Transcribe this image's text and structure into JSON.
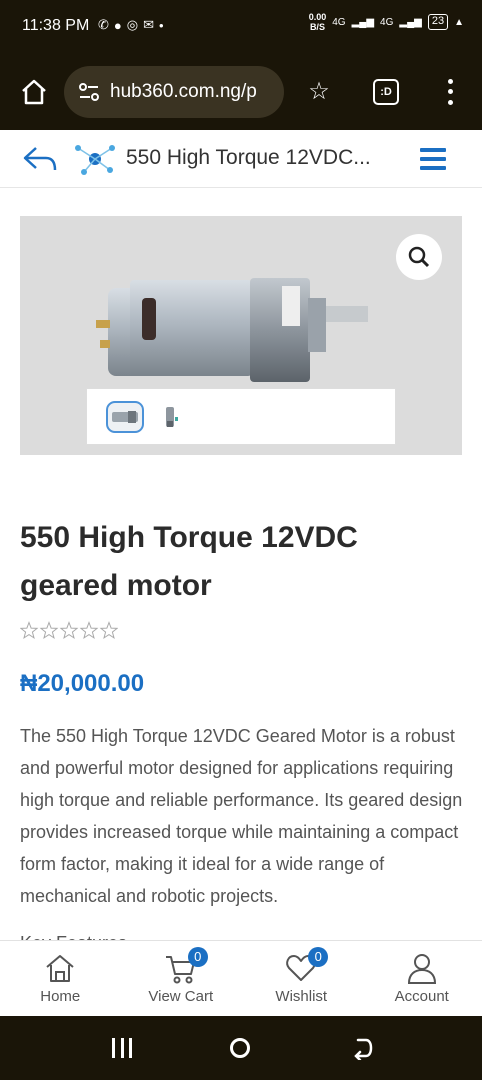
{
  "status_bar": {
    "time": "11:38 PM",
    "net_speed_value": "0.00",
    "net_speed_unit": "B/S",
    "network1": "4G",
    "network2": "4G",
    "battery": "23"
  },
  "browser": {
    "url": "hub360.com.ng/p",
    "extension_label": ":D"
  },
  "header": {
    "title": "550 High Torque 12VDC..."
  },
  "product": {
    "title": "550 High Torque 12VDC geared motor",
    "rating_stars": 0,
    "rating_max": 5,
    "price": "₦20,000.00",
    "description": "The 550 High Torque 12VDC Geared Motor is a robust and powerful motor designed for applications requiring high torque and reliable performance. Its geared design provides increased torque while maintaining a compact form factor, making it ideal for a wide range of mechanical and robotic projects.",
    "next_section_partial": "Key Features"
  },
  "bottom_nav": {
    "home": "Home",
    "cart": "View Cart",
    "cart_count": "0",
    "wishlist": "Wishlist",
    "wishlist_count": "0",
    "account": "Account"
  },
  "colors": {
    "accent": "#1b6fc3",
    "system_bar": "#1a1508"
  }
}
